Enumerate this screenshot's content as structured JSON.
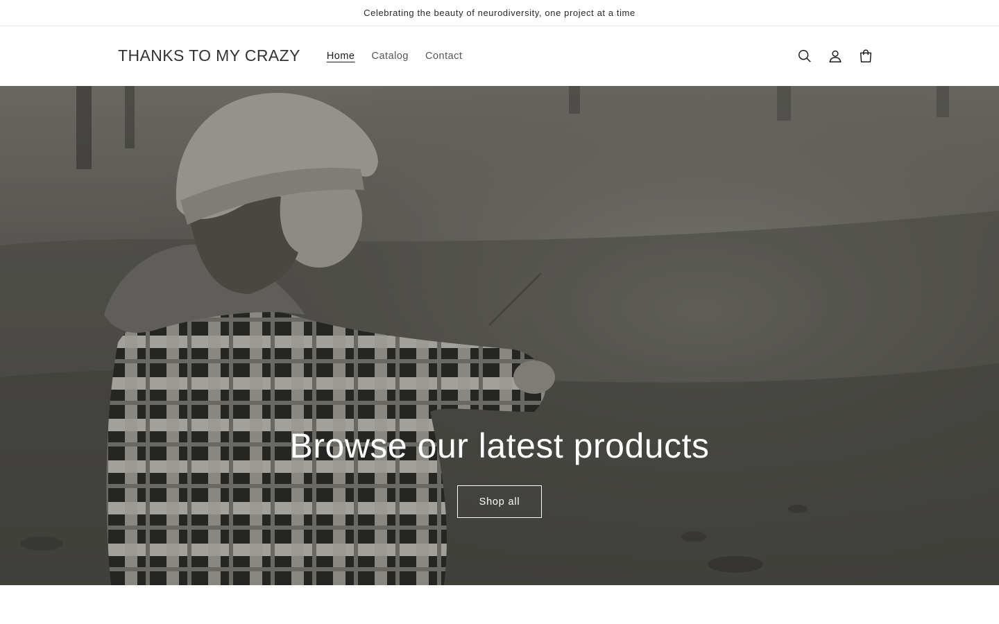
{
  "announcement": {
    "text": "Celebrating the beauty of neurodiversity, one project at a time"
  },
  "header": {
    "logo": "THANKS TO MY CRAZY",
    "nav": [
      {
        "label": "Home",
        "active": true
      },
      {
        "label": "Catalog",
        "active": false
      },
      {
        "label": "Contact",
        "active": false
      }
    ],
    "icons": [
      "search-icon",
      "account-icon",
      "cart-icon"
    ]
  },
  "hero": {
    "title": "Browse our latest products",
    "button_label": "Shop all",
    "image_description_icon": "hero-photo"
  },
  "colors": {
    "text": "#1a1a1a",
    "muted": "#555555",
    "hero_text": "#ffffff",
    "border": "#e8e8e8"
  }
}
